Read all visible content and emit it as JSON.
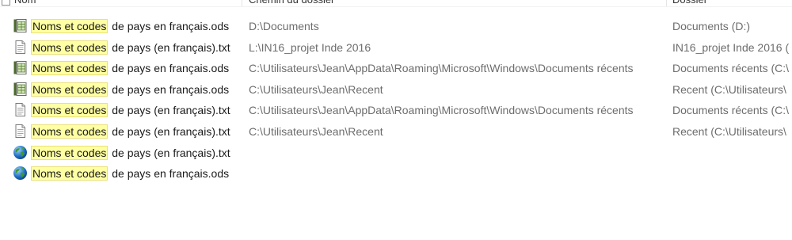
{
  "header": {
    "name": "Nom",
    "path": "Chemin du dossier",
    "folder": "Dossier"
  },
  "rows": [
    {
      "icon": "spreadsheet-icon",
      "match": "Noms et codes",
      "rest": " de pays en français.ods",
      "path": "D:\\Documents",
      "folder": "Documents (D:)"
    },
    {
      "icon": "text-file-icon",
      "match": "Noms et codes",
      "rest": " de pays (en français).txt",
      "path": "L:\\IN16_projet Inde 2016",
      "folder": "IN16_projet Inde 2016 ("
    },
    {
      "icon": "spreadsheet-icon",
      "match": "Noms et codes",
      "rest": " de pays en français.ods",
      "path": "C:\\Utilisateurs\\Jean\\AppData\\Roaming\\Microsoft\\Windows\\Documents récents",
      "folder": "Documents récents (C:\\"
    },
    {
      "icon": "spreadsheet-icon",
      "match": "Noms et codes",
      "rest": " de pays en français.ods",
      "path": "C:\\Utilisateurs\\Jean\\Recent",
      "folder": "Recent (C:\\Utilisateurs\\"
    },
    {
      "icon": "text-file-icon",
      "match": "Noms et codes",
      "rest": " de pays (en français).txt",
      "path": "C:\\Utilisateurs\\Jean\\AppData\\Roaming\\Microsoft\\Windows\\Documents récents",
      "folder": "Documents récents (C:\\"
    },
    {
      "icon": "text-file-icon",
      "match": "Noms et codes",
      "rest": " de pays (en français).txt",
      "path": "C:\\Utilisateurs\\Jean\\Recent",
      "folder": "Recent (C:\\Utilisateurs\\"
    },
    {
      "icon": "globe-icon",
      "match": "Noms et codes",
      "rest": " de pays (en français).txt",
      "path": "",
      "folder": ""
    },
    {
      "icon": "globe-icon",
      "match": "Noms et codes",
      "rest": " de pays en français.ods",
      "path": "",
      "folder": ""
    }
  ],
  "colors": {
    "highlight": "#ffffa3",
    "secondary_text": "#6d6d6d"
  }
}
